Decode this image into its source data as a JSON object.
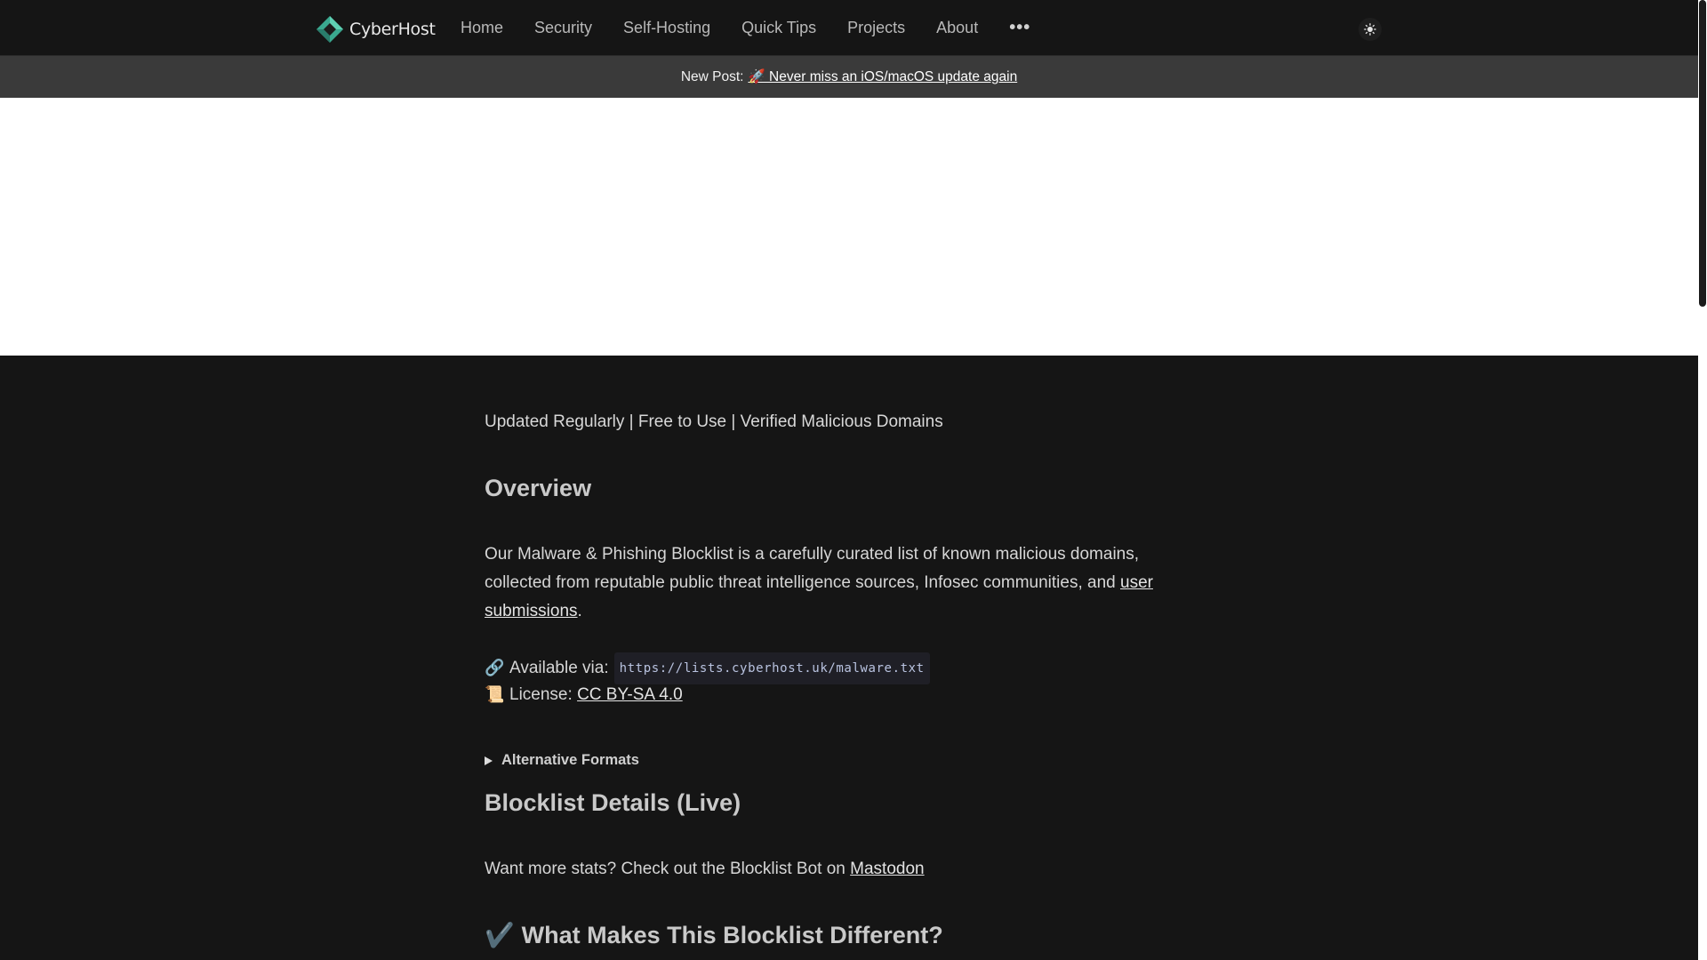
{
  "navbar": {
    "brand": "CyberHost",
    "links": [
      "Home",
      "Security",
      "Self-Hosting",
      "Quick Tips",
      "Projects",
      "About"
    ],
    "more_label": "•••",
    "theme_icon": "sun-icon"
  },
  "announcement": {
    "prefix": "New Post:",
    "link_text": "🚀 Never miss an iOS/macOS update again"
  },
  "content": {
    "tagline": "Updated Regularly | Free to Use | Verified Malicious Domains",
    "overview_heading": "Overview",
    "overview_text_1": "Our Malware & Phishing Blocklist is a carefully curated list of known malicious domains, collected from reputable public threat intelligence sources, Infosec communities, and ",
    "overview_link": "user submissions",
    "overview_text_2": ".",
    "available_emoji": "🔗",
    "available_label": "Available via:",
    "available_url": "https://lists.cyberhost.uk/malware.txt",
    "license_emoji": "📜",
    "license_label": "License:",
    "license_link": "CC BY-SA 4.0",
    "alt_formats_summary": "Alternative Formats",
    "details_heading": "Blocklist Details (Live)",
    "stats_text": "Want more stats? Check out the Blocklist Bot on ",
    "stats_link": "Mastodon",
    "different_icon": "✔️",
    "different_heading": "What Makes This Blocklist Different?"
  }
}
